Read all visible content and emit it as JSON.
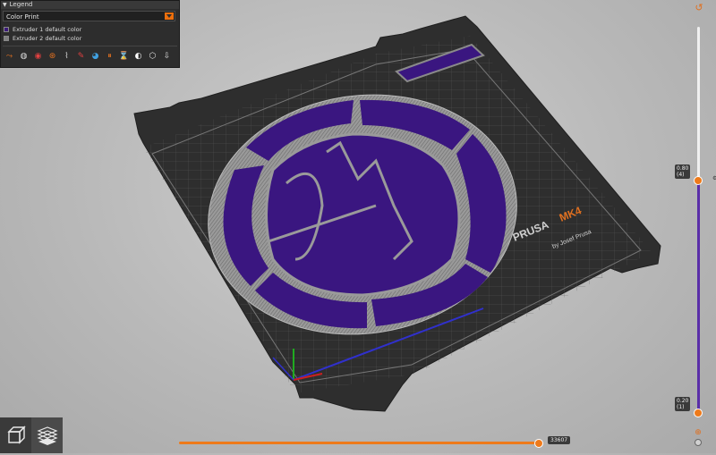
{
  "legend": {
    "title": "Legend",
    "view_type": "Color Print",
    "items": [
      {
        "label": "Extruder 1 default color",
        "color": "#3c1a7a"
      },
      {
        "label": "Extruder 2 default color",
        "color": "#808080"
      }
    ],
    "toolbar_icons": [
      "travel-icon",
      "wipe-icon",
      "retractions-icon",
      "deretractions-icon",
      "seams-icon",
      "tool-changes-icon",
      "color-changes-icon",
      "pause-prints-icon",
      "custom-gcodes-icon",
      "center-of-gravity-icon",
      "shells-icon",
      "tool-marker-icon"
    ]
  },
  "bed": {
    "brand": "PRUSA",
    "model": "MK4",
    "byline": "by Josef Prusa",
    "print_color": "#3a1680",
    "perimeter_color": "#8a8a8a"
  },
  "vertical_slider": {
    "upper_value": "0.80",
    "upper_layer": "(4)",
    "lower_value": "0.20",
    "lower_layer": "(1)"
  },
  "horizontal_slider": {
    "value": "33607"
  },
  "colors": {
    "accent": "#ee7a1a",
    "range": "#5a2ea8",
    "panel": "#2d2d2d"
  }
}
